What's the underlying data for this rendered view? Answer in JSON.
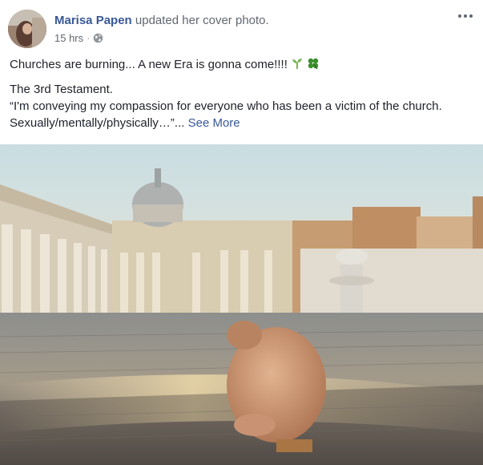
{
  "post": {
    "author_name": "Marisa Papen",
    "action_text": "updated her cover photo.",
    "timestamp": "15 hrs",
    "separator": "·",
    "privacy_icon": "globe-icon",
    "more_icon": "ellipsis-icon",
    "status_text": "Churches are burning... A new Era is gonna come!!!!",
    "status_emojis": [
      "sprout-icon",
      "four-leaf-clover-icon"
    ],
    "description_title": "The 3rd Testament.",
    "description_quote": "“I'm conveying my compassion for everyone who has been a victim of the church. Sexually/mentally/physically…”...",
    "see_more_label": "See More",
    "photo_subject": "cover-photo"
  },
  "colors": {
    "link_blue": "#385898",
    "text_dark": "#1d2129",
    "text_gray": "#616770"
  }
}
